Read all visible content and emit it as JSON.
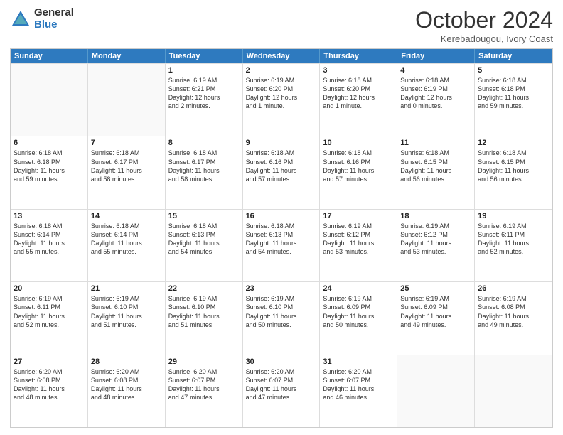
{
  "logo": {
    "general": "General",
    "blue": "Blue"
  },
  "header": {
    "title": "October 2024",
    "subtitle": "Kerebadougou, Ivory Coast"
  },
  "weekdays": [
    "Sunday",
    "Monday",
    "Tuesday",
    "Wednesday",
    "Thursday",
    "Friday",
    "Saturday"
  ],
  "rows": [
    [
      {
        "day": "",
        "lines": [],
        "empty": true
      },
      {
        "day": "",
        "lines": [],
        "empty": true
      },
      {
        "day": "1",
        "lines": [
          "Sunrise: 6:19 AM",
          "Sunset: 6:21 PM",
          "Daylight: 12 hours",
          "and 2 minutes."
        ],
        "empty": false
      },
      {
        "day": "2",
        "lines": [
          "Sunrise: 6:19 AM",
          "Sunset: 6:20 PM",
          "Daylight: 12 hours",
          "and 1 minute."
        ],
        "empty": false
      },
      {
        "day": "3",
        "lines": [
          "Sunrise: 6:18 AM",
          "Sunset: 6:20 PM",
          "Daylight: 12 hours",
          "and 1 minute."
        ],
        "empty": false
      },
      {
        "day": "4",
        "lines": [
          "Sunrise: 6:18 AM",
          "Sunset: 6:19 PM",
          "Daylight: 12 hours",
          "and 0 minutes."
        ],
        "empty": false
      },
      {
        "day": "5",
        "lines": [
          "Sunrise: 6:18 AM",
          "Sunset: 6:18 PM",
          "Daylight: 11 hours",
          "and 59 minutes."
        ],
        "empty": false
      }
    ],
    [
      {
        "day": "6",
        "lines": [
          "Sunrise: 6:18 AM",
          "Sunset: 6:18 PM",
          "Daylight: 11 hours",
          "and 59 minutes."
        ],
        "empty": false
      },
      {
        "day": "7",
        "lines": [
          "Sunrise: 6:18 AM",
          "Sunset: 6:17 PM",
          "Daylight: 11 hours",
          "and 58 minutes."
        ],
        "empty": false
      },
      {
        "day": "8",
        "lines": [
          "Sunrise: 6:18 AM",
          "Sunset: 6:17 PM",
          "Daylight: 11 hours",
          "and 58 minutes."
        ],
        "empty": false
      },
      {
        "day": "9",
        "lines": [
          "Sunrise: 6:18 AM",
          "Sunset: 6:16 PM",
          "Daylight: 11 hours",
          "and 57 minutes."
        ],
        "empty": false
      },
      {
        "day": "10",
        "lines": [
          "Sunrise: 6:18 AM",
          "Sunset: 6:16 PM",
          "Daylight: 11 hours",
          "and 57 minutes."
        ],
        "empty": false
      },
      {
        "day": "11",
        "lines": [
          "Sunrise: 6:18 AM",
          "Sunset: 6:15 PM",
          "Daylight: 11 hours",
          "and 56 minutes."
        ],
        "empty": false
      },
      {
        "day": "12",
        "lines": [
          "Sunrise: 6:18 AM",
          "Sunset: 6:15 PM",
          "Daylight: 11 hours",
          "and 56 minutes."
        ],
        "empty": false
      }
    ],
    [
      {
        "day": "13",
        "lines": [
          "Sunrise: 6:18 AM",
          "Sunset: 6:14 PM",
          "Daylight: 11 hours",
          "and 55 minutes."
        ],
        "empty": false
      },
      {
        "day": "14",
        "lines": [
          "Sunrise: 6:18 AM",
          "Sunset: 6:14 PM",
          "Daylight: 11 hours",
          "and 55 minutes."
        ],
        "empty": false
      },
      {
        "day": "15",
        "lines": [
          "Sunrise: 6:18 AM",
          "Sunset: 6:13 PM",
          "Daylight: 11 hours",
          "and 54 minutes."
        ],
        "empty": false
      },
      {
        "day": "16",
        "lines": [
          "Sunrise: 6:18 AM",
          "Sunset: 6:13 PM",
          "Daylight: 11 hours",
          "and 54 minutes."
        ],
        "empty": false
      },
      {
        "day": "17",
        "lines": [
          "Sunrise: 6:19 AM",
          "Sunset: 6:12 PM",
          "Daylight: 11 hours",
          "and 53 minutes."
        ],
        "empty": false
      },
      {
        "day": "18",
        "lines": [
          "Sunrise: 6:19 AM",
          "Sunset: 6:12 PM",
          "Daylight: 11 hours",
          "and 53 minutes."
        ],
        "empty": false
      },
      {
        "day": "19",
        "lines": [
          "Sunrise: 6:19 AM",
          "Sunset: 6:11 PM",
          "Daylight: 11 hours",
          "and 52 minutes."
        ],
        "empty": false
      }
    ],
    [
      {
        "day": "20",
        "lines": [
          "Sunrise: 6:19 AM",
          "Sunset: 6:11 PM",
          "Daylight: 11 hours",
          "and 52 minutes."
        ],
        "empty": false
      },
      {
        "day": "21",
        "lines": [
          "Sunrise: 6:19 AM",
          "Sunset: 6:10 PM",
          "Daylight: 11 hours",
          "and 51 minutes."
        ],
        "empty": false
      },
      {
        "day": "22",
        "lines": [
          "Sunrise: 6:19 AM",
          "Sunset: 6:10 PM",
          "Daylight: 11 hours",
          "and 51 minutes."
        ],
        "empty": false
      },
      {
        "day": "23",
        "lines": [
          "Sunrise: 6:19 AM",
          "Sunset: 6:10 PM",
          "Daylight: 11 hours",
          "and 50 minutes."
        ],
        "empty": false
      },
      {
        "day": "24",
        "lines": [
          "Sunrise: 6:19 AM",
          "Sunset: 6:09 PM",
          "Daylight: 11 hours",
          "and 50 minutes."
        ],
        "empty": false
      },
      {
        "day": "25",
        "lines": [
          "Sunrise: 6:19 AM",
          "Sunset: 6:09 PM",
          "Daylight: 11 hours",
          "and 49 minutes."
        ],
        "empty": false
      },
      {
        "day": "26",
        "lines": [
          "Sunrise: 6:19 AM",
          "Sunset: 6:08 PM",
          "Daylight: 11 hours",
          "and 49 minutes."
        ],
        "empty": false
      }
    ],
    [
      {
        "day": "27",
        "lines": [
          "Sunrise: 6:20 AM",
          "Sunset: 6:08 PM",
          "Daylight: 11 hours",
          "and 48 minutes."
        ],
        "empty": false
      },
      {
        "day": "28",
        "lines": [
          "Sunrise: 6:20 AM",
          "Sunset: 6:08 PM",
          "Daylight: 11 hours",
          "and 48 minutes."
        ],
        "empty": false
      },
      {
        "day": "29",
        "lines": [
          "Sunrise: 6:20 AM",
          "Sunset: 6:07 PM",
          "Daylight: 11 hours",
          "and 47 minutes."
        ],
        "empty": false
      },
      {
        "day": "30",
        "lines": [
          "Sunrise: 6:20 AM",
          "Sunset: 6:07 PM",
          "Daylight: 11 hours",
          "and 47 minutes."
        ],
        "empty": false
      },
      {
        "day": "31",
        "lines": [
          "Sunrise: 6:20 AM",
          "Sunset: 6:07 PM",
          "Daylight: 11 hours",
          "and 46 minutes."
        ],
        "empty": false
      },
      {
        "day": "",
        "lines": [],
        "empty": true
      },
      {
        "day": "",
        "lines": [],
        "empty": true
      }
    ]
  ]
}
